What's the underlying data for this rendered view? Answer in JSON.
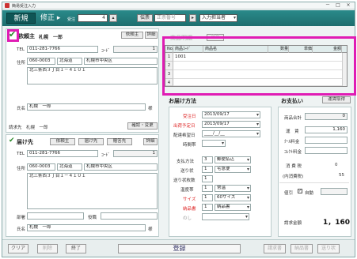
{
  "window": {
    "title": "簡易受注入力",
    "minimize": "－",
    "maximize": "□",
    "close": "×"
  },
  "toolbar": {
    "new_label": "新規",
    "edit_label": "修正",
    "order_no_label": "受注",
    "order_no_value": "4",
    "customer_btn": "伝票",
    "customer_input_placeholder": "正票番号",
    "staff_placeholder": "入力担当者"
  },
  "client": {
    "title": "依頼主",
    "name": "札幌　一郎",
    "client_btn": "依頼主",
    "detail_btn": "詳細",
    "tel_label": "TEL",
    "tel_value": "011-281-7766",
    "code_label": "ｺｰﾄﾞ",
    "code_value": "1",
    "address_label": "住所",
    "postal": "060-0003",
    "pref": "北海道",
    "city": "札幌市中央区",
    "address1": "北三条西３丁目１－４１０１",
    "name_label": "氏名",
    "name_value": "札幌　一郎",
    "honor": "様",
    "billto_label": "請求先",
    "billto_value": "札幌　一郎",
    "confirm_btn": "確認・変更"
  },
  "delivery": {
    "title": "届け先",
    "client_btn": "依頼主",
    "dest_btn": "届け先",
    "gift_btn": "贈答先",
    "detail_btn": "詳細",
    "tel_label": "TEL",
    "tel_value": "011-281-7766",
    "code_label": "ｺｰﾄﾞ",
    "code_value": "1",
    "address_label": "住所",
    "postal": "060-0003",
    "pref": "北海道",
    "city": "札幌市中央区",
    "address1": "北三条西３丁目１－４１０１",
    "dept_label": "部署",
    "position_label": "役職",
    "name_label": "氏名",
    "name_value": "札幌　一郎",
    "honor": "様"
  },
  "products": {
    "title": "商品明細",
    "add_btn": "追加",
    "columns": [
      "No.",
      "商品ｺｰﾄﾞ",
      "商品名",
      "数量",
      "単価",
      "金額"
    ],
    "rows": [
      {
        "no": "1",
        "code": "1001"
      },
      {
        "no": "2",
        "code": ""
      },
      {
        "no": "3",
        "code": ""
      },
      {
        "no": "4",
        "code": ""
      }
    ]
  },
  "shipping": {
    "title": "お届け方法",
    "order_date_label": "受注日",
    "order_date": "2013/09/17",
    "ship_date_label": "出荷予定日",
    "ship_date": "2013/09/17",
    "delivery_date_label": "配達希望日",
    "delivery_date": "____/__/__",
    "time_label": "時間帯",
    "payment_label": "支払方法",
    "payment_code": "3",
    "payment_value": "郵便払込",
    "carrier_label": "送り状",
    "carrier_code": "1",
    "carrier_value": "宅急便",
    "slips_label": "送り状枚数",
    "slips_value": "1",
    "temp_label": "温度帯",
    "temp_code": "1",
    "temp_value": "常温",
    "size_label": "サイズ",
    "size_code": "1",
    "size_value": "60サイズ",
    "delivery_note_label": "納品書",
    "delivery_note_code": "1",
    "delivery_note_value": "納品書",
    "noshi_label": "のし"
  },
  "payment": {
    "title": "お支払い",
    "recalc_btn": "運賃取得",
    "subtotal_label": "商品合計",
    "subtotal_value": "0",
    "freight_label": "運　賃",
    "freight_value": "1,160",
    "cool_label": "ｸｰﾙ料金",
    "cod_label": "ｺﾚｸﾄ料金",
    "tax_label": "消 費 税",
    "tax_value": "0",
    "inner_tax_label": "(内消費税)",
    "inner_tax_value": "55",
    "round_label": "値引",
    "auto_label": "自動",
    "total_label": "請求金額",
    "total_value": "1，160"
  },
  "footer": {
    "clear": "クリア",
    "delete": "削除",
    "finish": "終了",
    "register": "登録",
    "invoice": "請求書",
    "delivery_slip": "納品書",
    "shipping_label": "送り状"
  }
}
